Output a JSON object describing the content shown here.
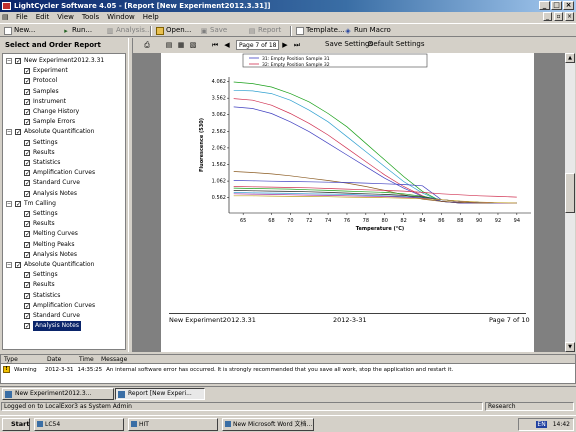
{
  "window": {
    "title": "LightCycler Software 4.05 - [Report [New Experiment2012.3.31]]",
    "minimize": "_",
    "maximize": "□",
    "close": "×"
  },
  "menu": [
    "File",
    "Edit",
    "View",
    "Tools",
    "Window",
    "Help"
  ],
  "toolbar": {
    "new": "New...",
    "run": "Run...",
    "analysis": "Analysis...",
    "open": "Open...",
    "save": "Save",
    "report": "Report",
    "template": "Template...",
    "run_macro": "Run Macro"
  },
  "left_panel": {
    "heading": "Select and Order Report Sections",
    "tree": [
      {
        "label": "New Experiment2012.3.31",
        "level": 0,
        "checked": true,
        "expand": "−"
      },
      {
        "label": "Experiment",
        "level": 1,
        "checked": true
      },
      {
        "label": "Protocol",
        "level": 1,
        "checked": true
      },
      {
        "label": "Samples",
        "level": 1,
        "checked": true
      },
      {
        "label": "Instrument",
        "level": 1,
        "checked": true
      },
      {
        "label": "Change History",
        "level": 1,
        "checked": true
      },
      {
        "label": "Sample Errors",
        "level": 1,
        "checked": true
      },
      {
        "label": "Absolute Quantification",
        "level": 0,
        "checked": true,
        "expand": "−"
      },
      {
        "label": "Settings",
        "level": 1,
        "checked": true
      },
      {
        "label": "Results",
        "level": 1,
        "checked": true
      },
      {
        "label": "Statistics",
        "level": 1,
        "checked": true
      },
      {
        "label": "Amplification Curves",
        "level": 1,
        "checked": true
      },
      {
        "label": "Standard Curve",
        "level": 1,
        "checked": true
      },
      {
        "label": "Analysis Notes",
        "level": 1,
        "checked": true
      },
      {
        "label": "Tm Calling",
        "level": 0,
        "checked": true,
        "expand": "−"
      },
      {
        "label": "Settings",
        "level": 1,
        "checked": true
      },
      {
        "label": "Results",
        "level": 1,
        "checked": true
      },
      {
        "label": "Melting Curves",
        "level": 1,
        "checked": true
      },
      {
        "label": "Melting Peaks",
        "level": 1,
        "checked": true
      },
      {
        "label": "Analysis Notes",
        "level": 1,
        "checked": true
      },
      {
        "label": "Absolute Quantification",
        "level": 0,
        "checked": true,
        "expand": "−"
      },
      {
        "label": "Settings",
        "level": 1,
        "checked": true
      },
      {
        "label": "Results",
        "level": 1,
        "checked": true
      },
      {
        "label": "Statistics",
        "level": 1,
        "checked": true
      },
      {
        "label": "Amplification Curves",
        "level": 1,
        "checked": true
      },
      {
        "label": "Standard Curve",
        "level": 1,
        "checked": true
      },
      {
        "label": "Analysis Notes",
        "level": 1,
        "checked": true,
        "selected": true
      }
    ]
  },
  "report_toolbar": {
    "page_field": "Page 7 of 18",
    "save_settings": "Save Settings",
    "default_settings": "Default Settings"
  },
  "report_page": {
    "legend": [
      "31: Empty Position Sample 31",
      "32: Empty Position Sample 32"
    ],
    "footer_left": "New Experiment2012.3.31",
    "footer_center": "2012-3-31",
    "footer_right": "Page 7 of 10"
  },
  "chart_data": {
    "type": "line",
    "xlabel": "Temperature (°C)",
    "ylabel": "Fluorescence (530)",
    "x_ticks": [
      65,
      68,
      70,
      72,
      74,
      76,
      78,
      80,
      82,
      84,
      86,
      88,
      90,
      92,
      94
    ],
    "y_ticks": [
      0.562,
      1.062,
      1.562,
      2.062,
      2.562,
      3.062,
      3.562,
      4.062
    ],
    "xlim": [
      63.5,
      95.5
    ],
    "ylim": [
      0.1,
      4.2
    ],
    "x": [
      64,
      66,
      68,
      70,
      72,
      74,
      76,
      78,
      80,
      82,
      84,
      86,
      88,
      90,
      92,
      94
    ],
    "series": [
      {
        "color": "#1aa01a",
        "values": [
          4.05,
          4.0,
          3.9,
          3.7,
          3.45,
          3.1,
          2.7,
          2.2,
          1.7,
          1.2,
          0.75,
          0.45,
          0.4,
          0.4,
          0.4,
          0.4
        ]
      },
      {
        "color": "#30a0d0",
        "values": [
          3.8,
          3.78,
          3.7,
          3.5,
          3.2,
          2.85,
          2.4,
          1.95,
          1.5,
          1.05,
          0.7,
          0.45,
          0.4,
          0.4,
          0.4,
          0.4
        ]
      },
      {
        "color": "#d03050",
        "values": [
          3.55,
          3.5,
          3.35,
          3.1,
          2.8,
          2.45,
          2.05,
          1.65,
          1.25,
          0.9,
          0.62,
          0.45,
          0.4,
          0.4,
          0.4,
          0.4
        ]
      },
      {
        "color": "#4040c0",
        "values": [
          3.3,
          3.25,
          3.1,
          2.85,
          2.55,
          2.2,
          1.85,
          1.5,
          1.15,
          0.85,
          0.6,
          0.45,
          0.4,
          0.4,
          0.4,
          0.4
        ]
      },
      {
        "color": "#8a5a20",
        "values": [
          1.35,
          1.32,
          1.28,
          1.22,
          1.15,
          1.08,
          1.0,
          0.9,
          0.78,
          0.65,
          0.52,
          0.45,
          0.42,
          0.4,
          0.4,
          0.4
        ]
      },
      {
        "color": "#4040c0",
        "values": [
          1.08,
          1.07,
          1.06,
          1.05,
          1.04,
          1.03,
          1.02,
          1.0,
          0.98,
          0.96,
          0.92,
          0.5,
          0.45,
          0.42,
          0.4,
          0.4
        ]
      },
      {
        "color": "#d03050",
        "values": [
          0.9,
          0.89,
          0.88,
          0.87,
          0.86,
          0.84,
          0.82,
          0.8,
          0.78,
          0.76,
          0.72,
          0.68,
          0.65,
          0.62,
          0.6,
          0.58
        ]
      },
      {
        "color": "#1aa01a",
        "values": [
          0.85,
          0.84,
          0.83,
          0.82,
          0.8,
          0.78,
          0.76,
          0.74,
          0.72,
          0.68,
          0.6,
          0.5,
          0.45,
          0.42,
          0.4,
          0.4
        ]
      },
      {
        "color": "#202020",
        "values": [
          0.78,
          0.77,
          0.76,
          0.75,
          0.74,
          0.72,
          0.7,
          0.68,
          0.66,
          0.63,
          0.58,
          0.5,
          0.45,
          0.42,
          0.4,
          0.4
        ]
      },
      {
        "color": "#30a0d0",
        "values": [
          0.72,
          0.71,
          0.7,
          0.69,
          0.68,
          0.67,
          0.66,
          0.64,
          0.62,
          0.6,
          0.56,
          0.5,
          0.45,
          0.42,
          0.4,
          0.4
        ]
      },
      {
        "color": "#a030a0",
        "values": [
          0.68,
          0.67,
          0.66,
          0.65,
          0.64,
          0.63,
          0.62,
          0.61,
          0.6,
          0.58,
          0.55,
          0.5,
          0.45,
          0.42,
          0.4,
          0.4
        ]
      },
      {
        "color": "#c0a020",
        "values": [
          0.62,
          0.62,
          0.61,
          0.6,
          0.6,
          0.59,
          0.58,
          0.57,
          0.56,
          0.55,
          0.53,
          0.5,
          0.46,
          0.43,
          0.41,
          0.4
        ]
      }
    ]
  },
  "status_list": {
    "headers": [
      "Type",
      "Date",
      "Time",
      "Message"
    ],
    "row": {
      "type": "Warning",
      "date": "2012-3-31",
      "time": "14:35:25",
      "message": "An internal software error has occurred. It is strongly recommended that you save all work, stop the application and restart it."
    }
  },
  "doc_tabs": [
    "New Experiment2012.3...",
    "Report [New Experi..."
  ],
  "status_bar": {
    "logged_on": "Logged on to LocalExor3 as System Admin",
    "mode": "Research"
  },
  "taskbar": {
    "start": "Start",
    "buttons": [
      "LC54",
      "HIT",
      "New Microsoft Word 文档..."
    ],
    "clock": "14:42",
    "lang": "EN"
  }
}
